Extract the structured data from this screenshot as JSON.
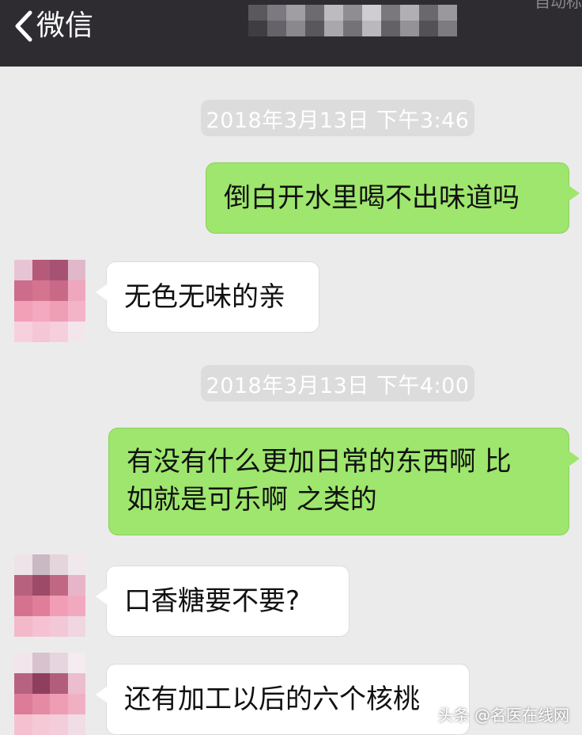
{
  "header": {
    "back_label": "微信",
    "corner_text": "自动标"
  },
  "messages": [
    {
      "type": "timestamp",
      "text": "2018年3月13日 下午3:46"
    },
    {
      "type": "sent",
      "text": "倒白开水里喝不出味道吗"
    },
    {
      "type": "received",
      "text": "无色无味的亲"
    },
    {
      "type": "timestamp",
      "text": "2018年3月13日 下午4:00"
    },
    {
      "type": "sent",
      "text": "有没有什么更加日常的东西啊 比如就是可乐啊 之类的",
      "lines": [
        "有没有什么更加日常的东西啊 比",
        "如就是可乐啊 之类的"
      ]
    },
    {
      "type": "received",
      "text": "口香糖要不要?"
    },
    {
      "type": "received",
      "text": "还有加工以后的六个核桃"
    }
  ],
  "watermark": "头条 @名医在线网",
  "colors": {
    "background": "#ebebeb",
    "topbar": "#2e2c31",
    "sent_bubble": "#9ee66d",
    "received_bubble": "#ffffff",
    "timestamp_bg": "#dcdcdc"
  }
}
